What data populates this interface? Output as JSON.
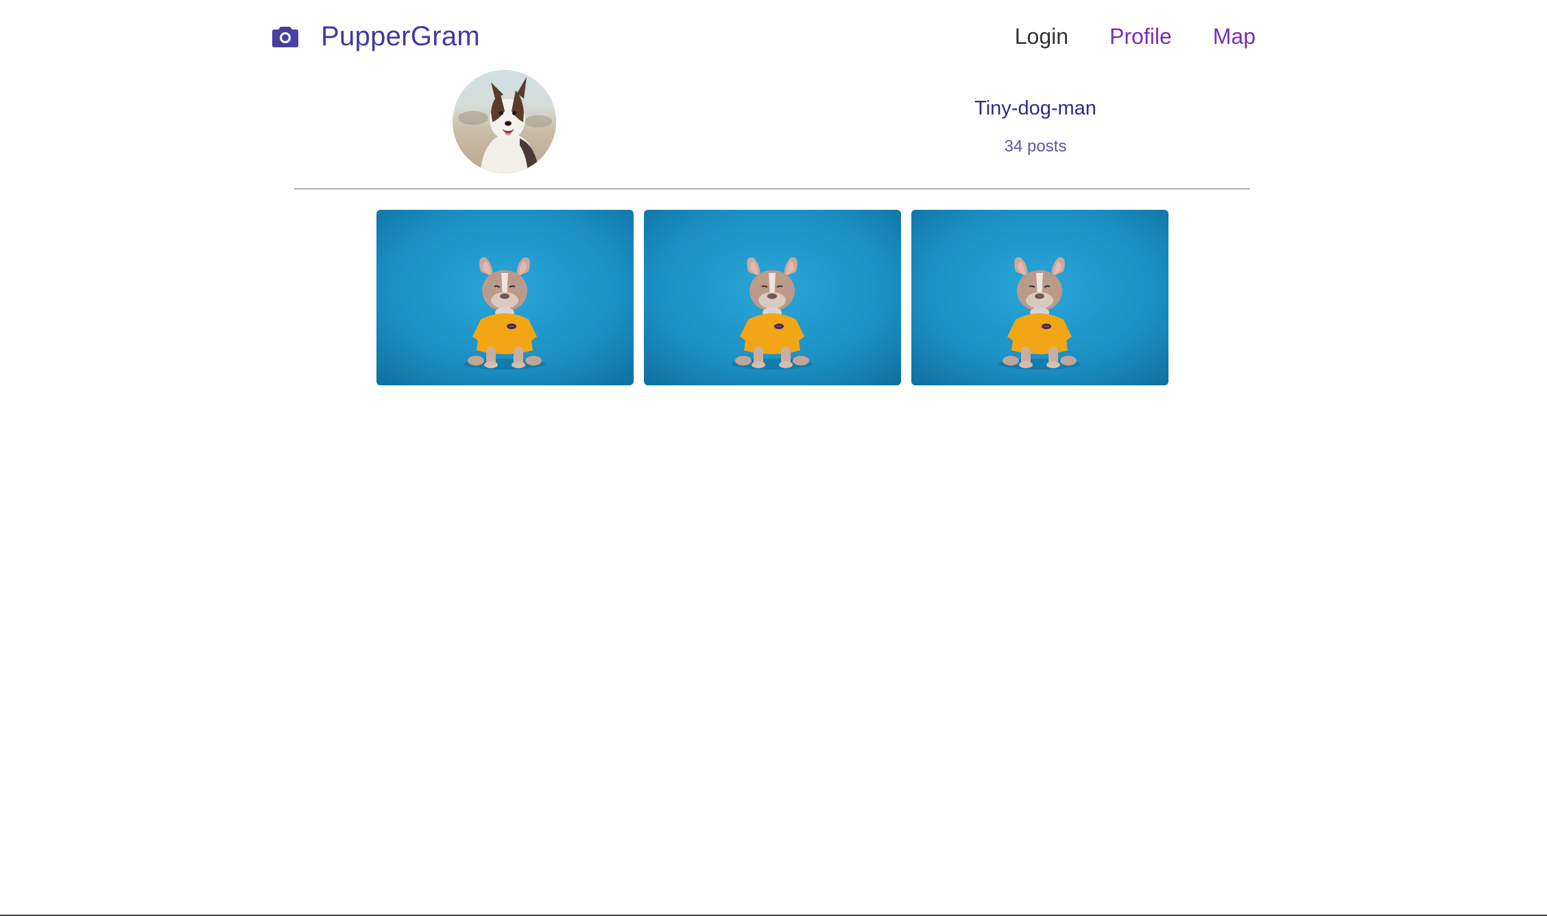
{
  "header": {
    "brand_icon": "camera-icon",
    "brand_title": "PupperGram",
    "nav": {
      "login": "Login",
      "profile": "Profile",
      "map": "Map"
    }
  },
  "profile": {
    "username": "Tiny-dog-man",
    "posts": "34 posts"
  },
  "colors": {
    "brand": "#3f3aa1",
    "nav_link": "#7a2eb3",
    "photo_bg": "#1a8fc2"
  }
}
